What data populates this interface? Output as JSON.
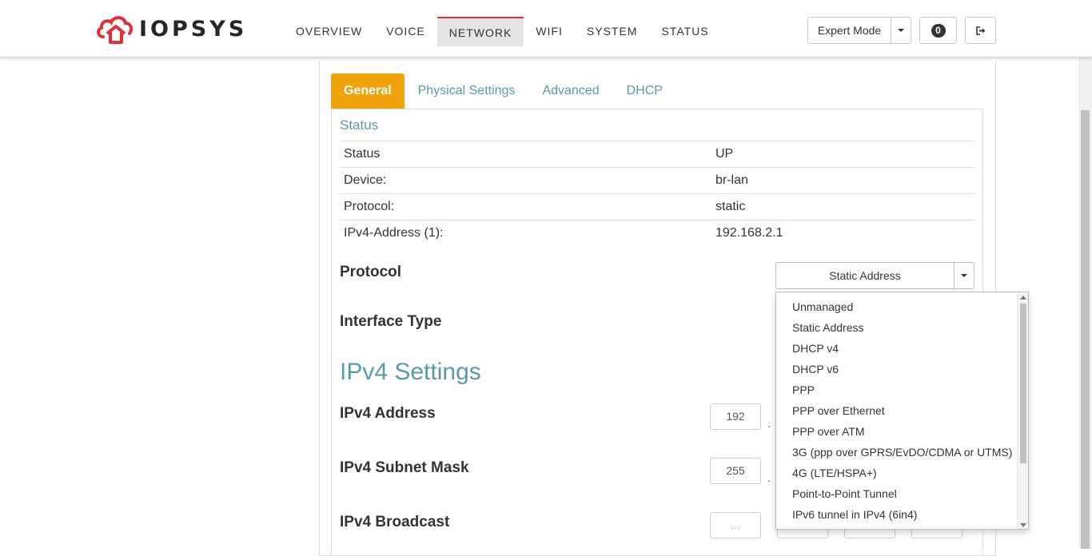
{
  "header": {
    "logo_text": "IOPSYS",
    "nav": [
      "OVERVIEW",
      "VOICE",
      "NETWORK",
      "WIFI",
      "SYSTEM",
      "STATUS"
    ],
    "active_nav": "NETWORK",
    "mode_button": "Expert Mode",
    "notification_count": "0"
  },
  "tabs": [
    "General",
    "Physical Settings",
    "Advanced",
    "DHCP"
  ],
  "active_tab": "General",
  "status": {
    "title": "Status",
    "rows": [
      {
        "label": "Status",
        "value": "UP"
      },
      {
        "label": "Device:",
        "value": "br-lan"
      },
      {
        "label": "Protocol:",
        "value": "static"
      },
      {
        "label": "IPv4-Address (1):",
        "value": "192.168.2.1"
      }
    ]
  },
  "protocol": {
    "label": "Protocol",
    "selected": "Static Address",
    "options": [
      "Unmanaged",
      "Static Address",
      "DHCP v4",
      "DHCP v6",
      "PPP",
      "PPP over Ethernet",
      "PPP over ATM",
      "3G (ppp over GPRS/EvDO/CDMA or UTMS)",
      "4G (LTE/HSPA+)",
      "Point-to-Point Tunnel",
      "IPv6 tunnel in IPv4 (6in4)"
    ]
  },
  "interface_type": {
    "label": "Interface Type"
  },
  "ipv4": {
    "title": "IPv4 Settings",
    "address_label": "IPv4 Address",
    "address_first_octet": "192",
    "subnet_label": "IPv4 Subnet Mask",
    "subnet_first_octet": "255",
    "broadcast_label": "IPv4 Broadcast",
    "broadcast_placeholder": "..."
  },
  "colors": {
    "accent_orange": "#f0a30a",
    "teal": "#5a9aa6",
    "nav_active_border": "#e0303a",
    "logo_red": "#e0303a"
  }
}
